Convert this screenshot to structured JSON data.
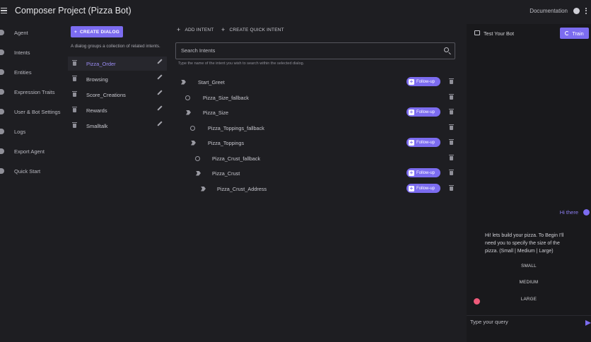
{
  "app": {
    "title": "Composer Project (Pizza Bot)",
    "documentation_label": "Documentation"
  },
  "sidebar": {
    "items": [
      {
        "label": "Agent"
      },
      {
        "label": "Intents"
      },
      {
        "label": "Entities"
      },
      {
        "label": "Expression Traits"
      },
      {
        "label": "User & Bot Settings"
      },
      {
        "label": "Logs"
      },
      {
        "label": "Export Agent"
      },
      {
        "label": "Quick Start"
      }
    ]
  },
  "dialogs": {
    "create_label": "CREATE DIALOG",
    "hint": "A dialog groups a collection of related intents.",
    "selected": "Pizza_Order",
    "items": [
      {
        "name": "Pizza_Order"
      },
      {
        "name": "Browsing"
      },
      {
        "name": "Score_Creations"
      },
      {
        "name": "Rewards"
      },
      {
        "name": "Smalltalk"
      }
    ]
  },
  "intents": {
    "add_label": "ADD INTENT",
    "add_quick_label": "CREATE QUICK INTENT",
    "search_placeholder": "Search Intents",
    "search_hint": "Type the name of the intent you wish to search within the selected dialog.",
    "follow_up_label": "Follow-up",
    "items": [
      {
        "name": "Start_Greet",
        "kind": "flow",
        "follow_up": true
      },
      {
        "name": "Pizza_Size_fallback",
        "kind": "fallback",
        "follow_up": false
      },
      {
        "name": "Pizza_Size",
        "kind": "flow",
        "follow_up": true
      },
      {
        "name": "Pizza_Toppings_fallback",
        "kind": "fallback",
        "follow_up": false
      },
      {
        "name": "Pizza_Toppings",
        "kind": "flow",
        "follow_up": true
      },
      {
        "name": "Pizza_Crust_fallback",
        "kind": "fallback",
        "follow_up": false
      },
      {
        "name": "Pizza_Crust",
        "kind": "flow",
        "follow_up": true
      },
      {
        "name": "Pizza_Crust_Address",
        "kind": "flow",
        "follow_up": true
      }
    ]
  },
  "chat": {
    "title": "Test Your Bot",
    "train_label": "Train",
    "user_message": "Hi there",
    "bot_message": "Hi! lets build your pizza. To Begin I'll need you to specify the size of the pizza. (Small | Medium | Large)",
    "options": [
      "SMALL",
      "MEDIUM",
      "LARGE"
    ],
    "input_placeholder": "Type your query"
  },
  "colors": {
    "accent": "#7c6cf0",
    "background": "#1e1e22",
    "chat_background": "#19191c"
  }
}
